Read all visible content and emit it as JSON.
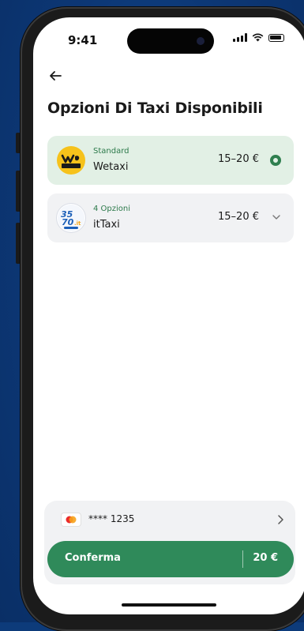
{
  "status_bar": {
    "time": "9:41"
  },
  "header": {
    "title": "Opzioni Di Taxi Disponibili"
  },
  "options": [
    {
      "subtitle": "Standard",
      "name": "Wetaxi",
      "price": "15–20 €",
      "logo_text": "WETAXI",
      "selected": true,
      "icon": "radio-selected-icon"
    },
    {
      "subtitle": "4 Opzioni",
      "name": "itTaxi",
      "price": "15–20 €",
      "logo_text": "3570.it",
      "selected": false,
      "icon": "chevron-down-icon"
    }
  ],
  "payment": {
    "card_mask": "**** 1235"
  },
  "confirm": {
    "label": "Conferma",
    "price": "20 €"
  },
  "colors": {
    "background": "#0d3b7a",
    "accent": "#2f8a5a",
    "selected_card": "#e2f0e5",
    "card": "#f1f2f4"
  }
}
